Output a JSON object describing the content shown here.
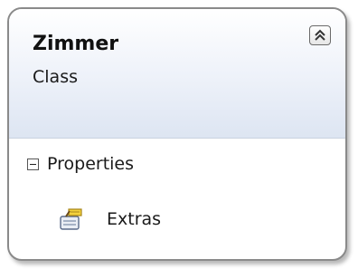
{
  "class_shape": {
    "name": "Zimmer",
    "stereotype": "Class",
    "collapse_icon": "double-chevron-up-icon",
    "sections": [
      {
        "title": "Properties",
        "expander_icon": "minus-box-icon",
        "members": [
          {
            "name": "Extras",
            "icon": "property-icon"
          }
        ]
      }
    ]
  },
  "colors": {
    "border": "#8a8a8a",
    "header_gradient_end": "#dde5f2"
  }
}
